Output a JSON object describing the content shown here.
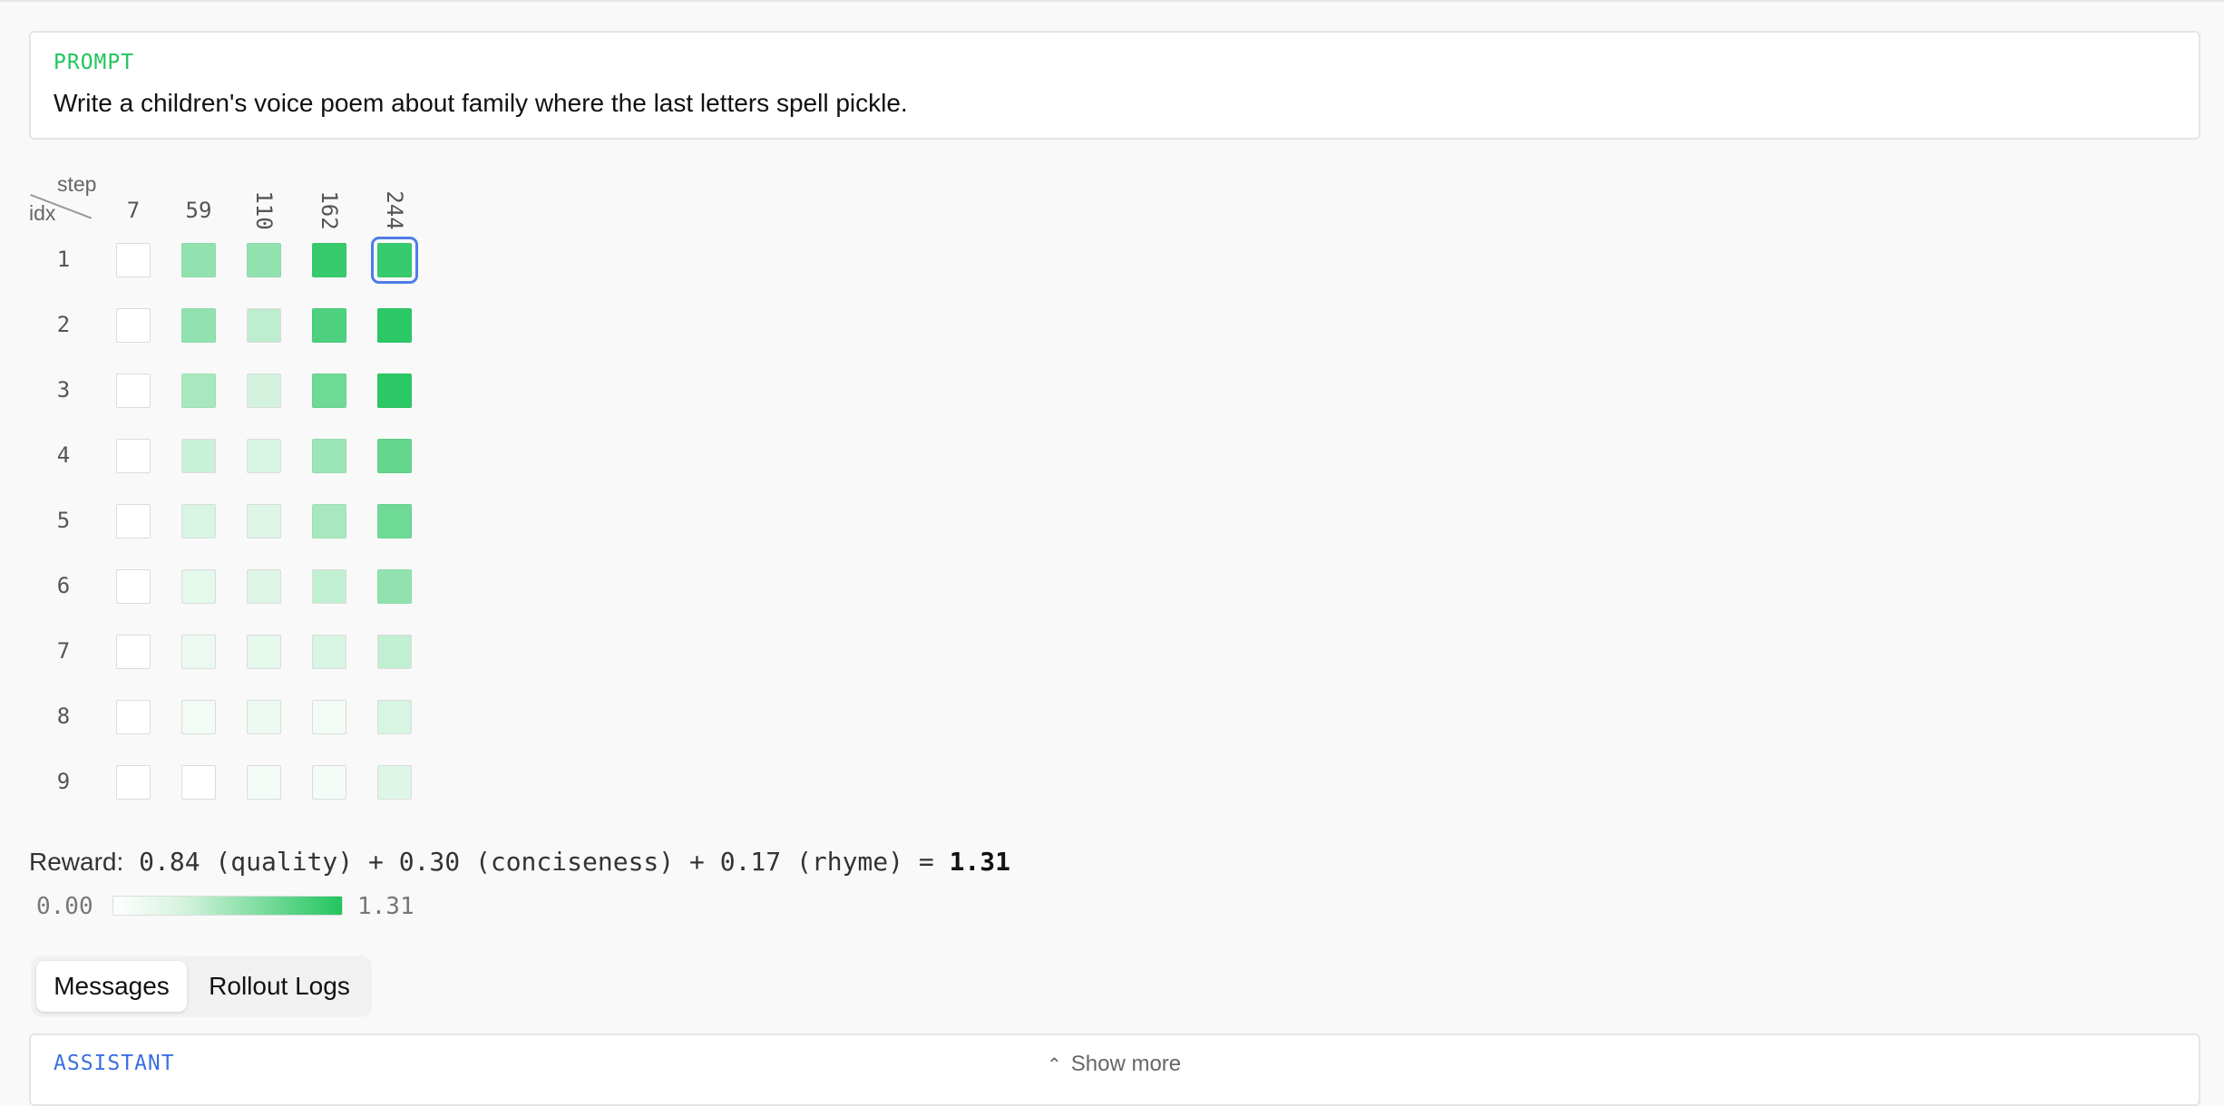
{
  "prompt": {
    "label": "PROMPT",
    "text": "Write a children's voice poem about family where the last letters spell pickle."
  },
  "heatmap": {
    "corner_top": "step",
    "corner_bottom": "idx",
    "columns": [
      "7",
      "59",
      "110",
      "162",
      "244"
    ],
    "rows": [
      "1",
      "2",
      "3",
      "4",
      "5",
      "6",
      "7",
      "8",
      "9"
    ],
    "intensity": [
      [
        0.0,
        0.5,
        0.5,
        0.9,
        0.9
      ],
      [
        0.0,
        0.5,
        0.3,
        0.8,
        0.95
      ],
      [
        0.0,
        0.4,
        0.2,
        0.65,
        0.95
      ],
      [
        0.0,
        0.25,
        0.18,
        0.45,
        0.7
      ],
      [
        0.0,
        0.18,
        0.15,
        0.4,
        0.65
      ],
      [
        0.0,
        0.12,
        0.15,
        0.28,
        0.5
      ],
      [
        0.0,
        0.08,
        0.12,
        0.18,
        0.28
      ],
      [
        0.0,
        0.06,
        0.08,
        0.06,
        0.18
      ],
      [
        0.0,
        0.0,
        0.05,
        0.05,
        0.15
      ]
    ],
    "selected": {
      "row": 0,
      "col": 4
    },
    "color_high": "#22c55e",
    "color_low": "#ffffff",
    "color_selected": "#4f7ce8"
  },
  "reward": {
    "label": "Reward:",
    "formula": "0.84 (quality) + 0.30 (conciseness) + 0.17 (rhyme) =",
    "total": "1.31",
    "scale_min": "0.00",
    "scale_max": "1.31"
  },
  "tabs": [
    {
      "label": "Messages",
      "active": true
    },
    {
      "label": "Rollout Logs",
      "active": false
    }
  ],
  "messages": {
    "role_label": "ASSISTANT",
    "show_more": "Show more"
  }
}
